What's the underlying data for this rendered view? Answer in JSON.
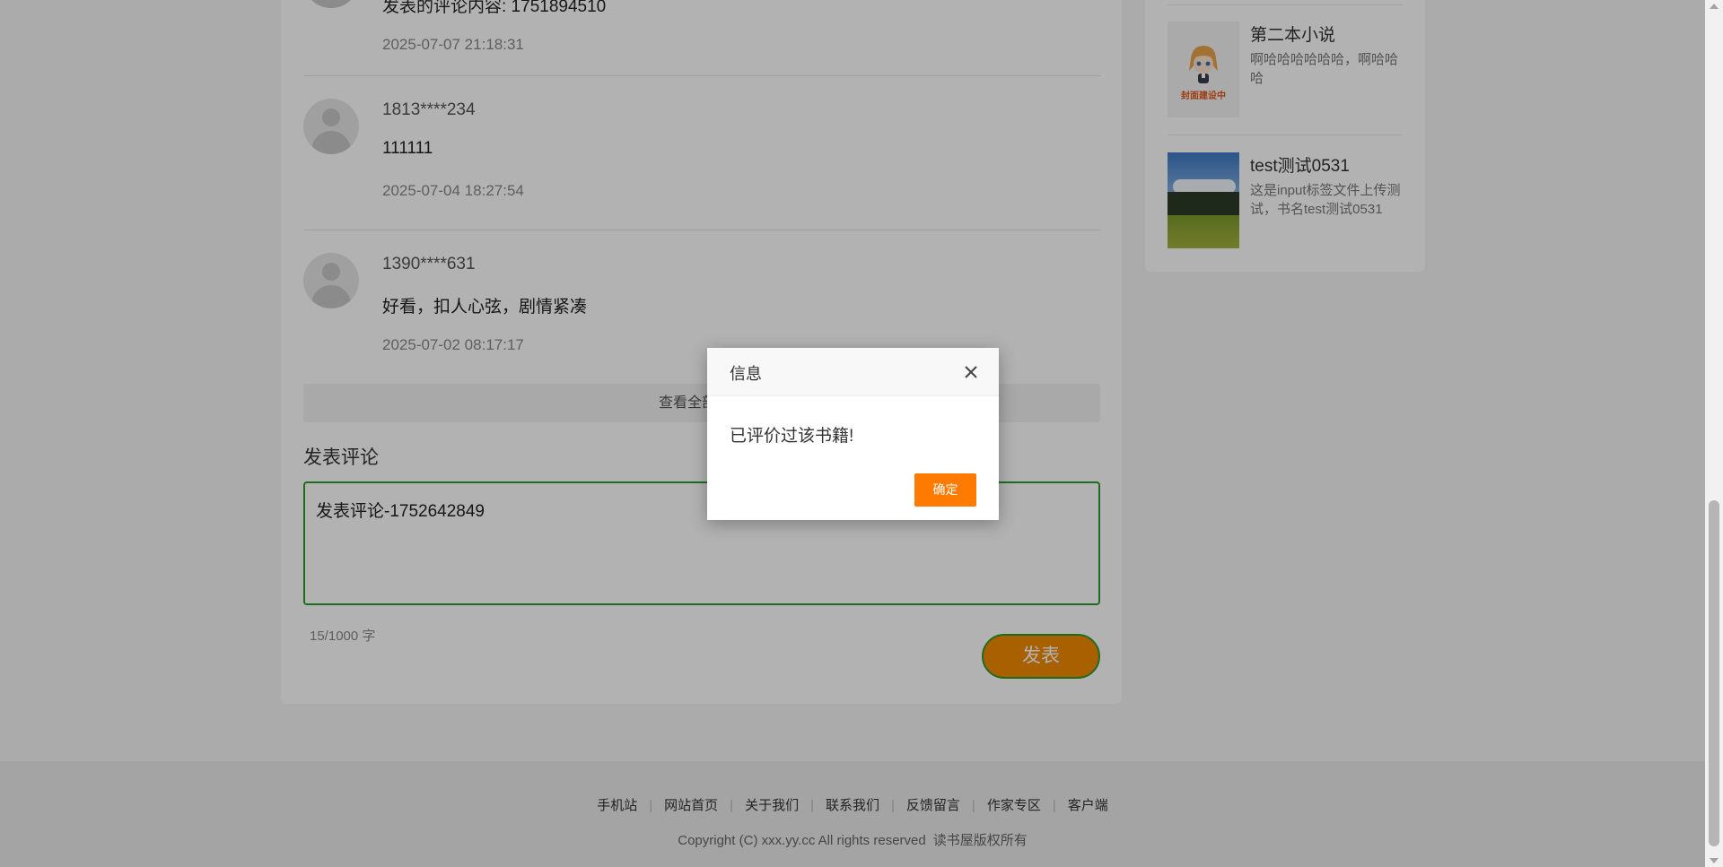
{
  "comments": [
    {
      "user": "",
      "text": "发表的评论内容: 1751894510",
      "time": "2025-07-07 21:18:31"
    },
    {
      "user": "1813****234",
      "text": "111111",
      "time": "2025-07-04 18:27:54"
    },
    {
      "user": "1390****631",
      "text": "好看，扣人心弦，剧情紧凑",
      "time": "2025-07-02 08:17:17"
    }
  ],
  "more_comments_label": "查看全部评论",
  "post": {
    "title": "发表评论",
    "textarea_value": "发表评论-1752642849",
    "char_count": "15/1000 字",
    "submit_label": "发表"
  },
  "sidebar": {
    "books": [
      {
        "title": "第二本小说",
        "desc": "啊哈哈哈哈哈哈，啊哈哈哈",
        "cover_label": "封面建设中"
      },
      {
        "title": "test测试0531",
        "desc": "这是input标签文件上传测试，书名test测试0531"
      }
    ]
  },
  "footer": {
    "links": [
      "手机站",
      "网站首页",
      "关于我们",
      "联系我们",
      "反馈留言",
      "作家专区",
      "客户端"
    ],
    "copyright": "Copyright (C) xxx.yy.cc All rights reserved",
    "copyright_suffix": "读书屋版权所有"
  },
  "dialog": {
    "title": "信息",
    "message": "已评价过该书籍!",
    "ok_label": "确定"
  },
  "colors": {
    "accent_orange": "#ff7a00",
    "submit_orange": "#f28a00",
    "focus_green": "#2b9c2b"
  }
}
